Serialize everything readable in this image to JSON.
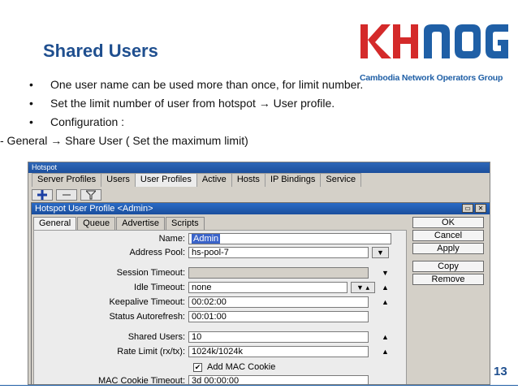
{
  "slide": {
    "title": "Shared Users",
    "bullets": [
      {
        "marker": "•",
        "text": "One user name can be used more than once, for limit number."
      },
      {
        "marker": "•",
        "text": "Set the limit number of user from hotspot → User profile."
      },
      {
        "marker": "•",
        "text": "Configuration :"
      },
      {
        "marker": "",
        "text": "- General → Share User ( Set the maximum limit)"
      }
    ],
    "page_number": "13"
  },
  "logo": {
    "name": "KHNOG",
    "subtitle": "Cambodia Network Operators Group",
    "colors": {
      "red": "#d42a2a",
      "blue": "#1f5fa6"
    }
  },
  "hotspot_window": {
    "title": "Hotspot",
    "tabs": [
      "Server Profiles",
      "Users",
      "User Profiles",
      "Active",
      "Hosts",
      "IP Bindings",
      "Service"
    ],
    "active_tab": "User Profiles",
    "toolbar": [
      "add-icon",
      "remove-icon",
      "filter-icon"
    ]
  },
  "profile_dialog": {
    "title": "Hotspot User Profile <Admin>",
    "tabs": [
      "General",
      "Queue",
      "Advertise",
      "Scripts"
    ],
    "active_tab": "General",
    "fields": {
      "name": {
        "label": "Name:",
        "value": "Admin"
      },
      "address_pool": {
        "label": "Address Pool:",
        "value": "hs-pool-7"
      },
      "session_timeout": {
        "label": "Session Timeout:",
        "value": ""
      },
      "idle_timeout": {
        "label": "Idle Timeout:",
        "value": "none"
      },
      "keepalive_timeout": {
        "label": "Keepalive Timeout:",
        "value": "00:02:00"
      },
      "status_autorefresh": {
        "label": "Status Autorefresh:",
        "value": "00:01:00"
      },
      "shared_users": {
        "label": "Shared Users:",
        "value": "10"
      },
      "rate_limit": {
        "label": "Rate Limit (rx/tx):",
        "value": "1024k/1024k"
      },
      "add_mac_cookie": {
        "label": "Add MAC Cookie",
        "checked": true
      },
      "mac_cookie_timeout": {
        "label": "MAC Cookie Timeout:",
        "value": "3d 00:00:00"
      }
    },
    "buttons": {
      "ok": "OK",
      "cancel": "Cancel",
      "apply": "Apply",
      "copy": "Copy",
      "remove": "Remove"
    }
  }
}
